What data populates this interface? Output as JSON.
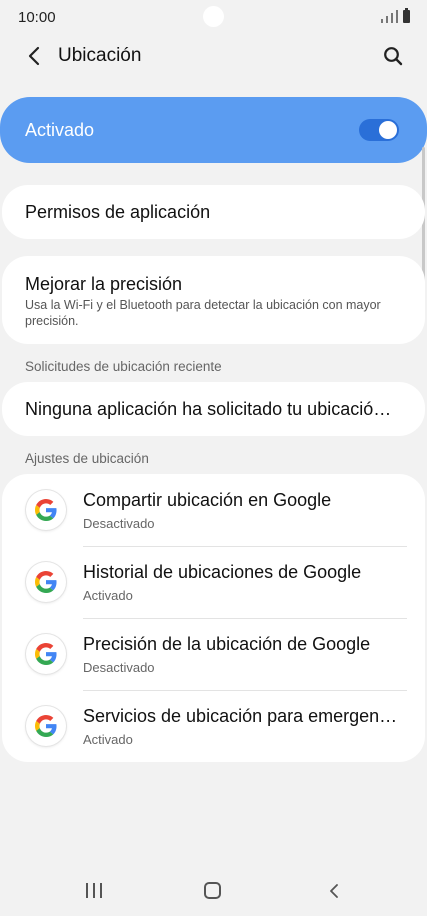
{
  "status_bar": {
    "time": "10:00"
  },
  "header": {
    "title": "Ubicación"
  },
  "master_switch": {
    "label": "Activado",
    "on": true,
    "color": "#5b9cf1"
  },
  "app_permissions": {
    "label": "Permisos de aplicación"
  },
  "accuracy": {
    "title": "Mejorar la precisión",
    "description": "Usa la Wi-Fi y el Bluetooth para detectar la ubicación con mayor precisión."
  },
  "recent_requests": {
    "header": "Solicitudes de ubicación reciente",
    "label": "Ninguna aplicación ha solicitado tu ubicación recientemente"
  },
  "location_settings": {
    "header": "Ajustes de ubicación",
    "items": [
      {
        "title": "Compartir ubicación en Google",
        "status": "Desactivado",
        "icon": "google-icon"
      },
      {
        "title": "Historial de ubicaciones de Google",
        "status": "Activado",
        "icon": "google-icon"
      },
      {
        "title": "Precisión de la ubicación de Google",
        "status": "Desactivado",
        "icon": "google-icon"
      },
      {
        "title": "Servicios de ubicación para emergencias",
        "status": "Activado",
        "icon": "google-icon"
      }
    ]
  }
}
